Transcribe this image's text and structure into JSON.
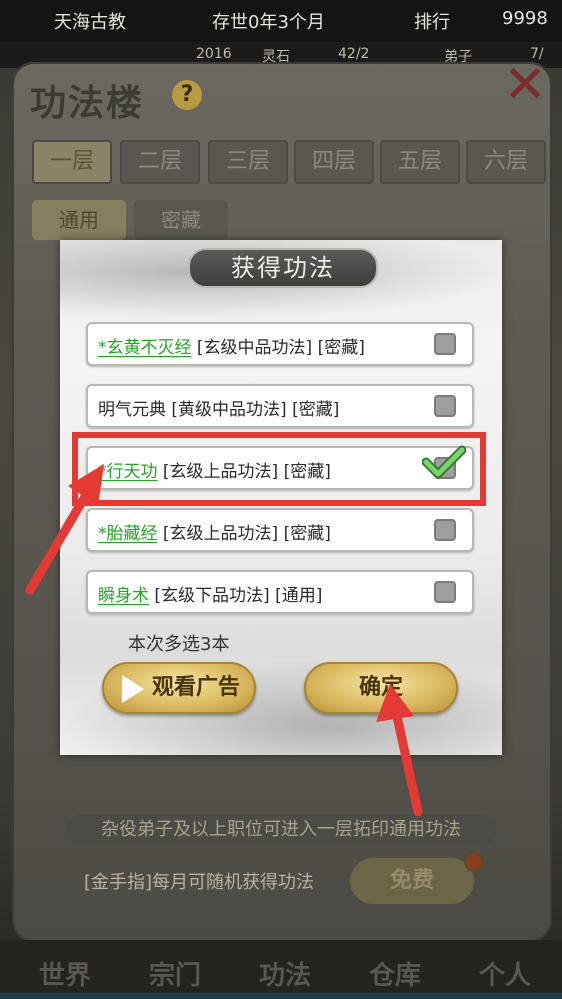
{
  "top_bar": {
    "sect_name": "天海古教",
    "age": "存世0年3个月",
    "rank_label": "排行",
    "rank_value": "9998"
  },
  "sub_bar": {
    "item1": "2016",
    "item2": "灵石",
    "item3": "42/2",
    "item4": "弟子",
    "item5": "7/"
  },
  "panel": {
    "title": "功法楼",
    "help": "?",
    "floors": [
      "一层",
      "二层",
      "三层",
      "四层",
      "五层",
      "六层"
    ],
    "sub_tabs": [
      "通用",
      "密藏"
    ]
  },
  "modal": {
    "title": "获得功法",
    "skills": [
      {
        "name": "*玄黄不灭经",
        "tags": "[玄级中品功法] [密藏]",
        "checked": false
      },
      {
        "name": "明气元典",
        "tags": "[黄级中品功法] [密藏]",
        "checked": false
      },
      {
        "name": "*行天功",
        "tags": "[玄级上品功法] [密藏]",
        "checked": true
      },
      {
        "name": "*胎藏经",
        "tags": "[玄级上品功法] [密藏]",
        "checked": false
      },
      {
        "name": "瞬身术",
        "tags": "[玄级下品功法] [通用]",
        "checked": false
      }
    ],
    "pick_hint": "本次多选3本",
    "watch_ad": "观看广告",
    "confirm": "确定"
  },
  "footer": {
    "rule": "杂役弟子及以上职位可进入一层拓印通用功法",
    "cheat": "[金手指]每月可随机获得功法",
    "free": "免费"
  },
  "bottom_nav": [
    "世界",
    "宗门",
    "功法",
    "仓库",
    "个人"
  ],
  "colors": {
    "highlight": "#e53935",
    "skill_name_green": "#21a821",
    "gold_button": "#dcbc63"
  }
}
